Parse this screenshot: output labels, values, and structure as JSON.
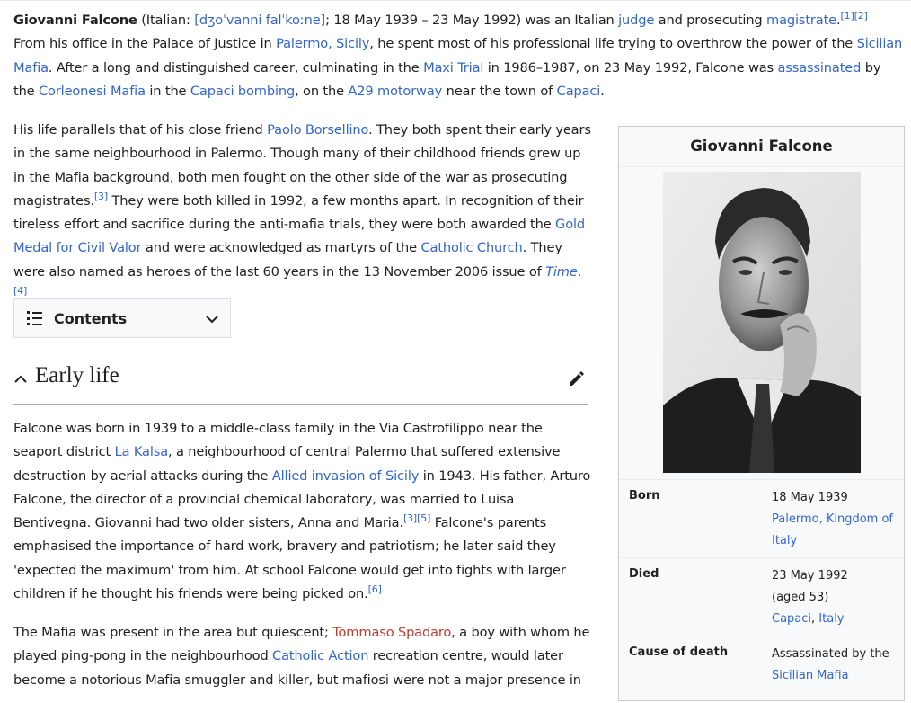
{
  "intro": {
    "name": "Giovanni Falcone",
    "t1": " (Italian: ",
    "ipa": "[dʒoˈvanni falˈkoːne]",
    "t2": "; 18 May 1939 – 23 May 1992) was an Italian ",
    "judge": "judge",
    "t3": " and prosecuting ",
    "magistrate": "magistrate",
    "ref1": "[1]",
    "ref2": "[2]",
    "t4": " From his office in the Palace of Justice in ",
    "palermo": "Palermo, Sicily",
    "t5": ", he spent most of his professional life trying to overthrow the power of the ",
    "sicilian_mafia": "Sicilian Mafia",
    "t6": ". After a long and distinguished career, culminating in the ",
    "maxi_trial": "Maxi Trial",
    "t7": " in 1986–1987, on 23 May 1992, Falcone was ",
    "assassinated": "assassinated",
    "t8": " by the ",
    "corleonesi": "Corleonesi Mafia",
    "t9": " in the ",
    "capaci_bombing": "Capaci bombing",
    "t10": ", on the ",
    "a29": "A29 motorway",
    "t11": " near the town of ",
    "capaci": "Capaci",
    "t12": "."
  },
  "para2": {
    "t1": "His life parallels that of his close friend ",
    "borsellino": "Paolo Borsellino",
    "t2": ". They both spent their early years in the same neighbourhood in Palermo. Though many of their childhood friends grew up in the Mafia background, both men fought on the other side of the war as prosecuting magistrates.",
    "ref3": "[3]",
    "t3": " They were both killed in 1992, a few months apart. In recognition of their tireless effort and sacrifice during the anti-mafia trials, they were both awarded the ",
    "gold_medal": "Gold Medal for Civil Valor",
    "t4": " and were acknowledged as martyrs of the ",
    "catholic_church": "Catholic Church",
    "t5": ". They were also named as heroes of the last 60 years in the 13 November 2006 issue of ",
    "time": "Time",
    "t6": ".",
    "ref4": "[4]"
  },
  "contents": {
    "label": "Contents"
  },
  "section": {
    "title": "Early life"
  },
  "para3": {
    "t1": "Falcone was born in 1939 to a middle-class family in the Via Castrofilippo near the seaport district ",
    "la_kalsa": "La Kalsa",
    "t2": ", a neighbourhood of central Palermo that suffered extensive destruction by aerial attacks during the ",
    "allied": "Allied invasion of Sicily",
    "t3": " in 1943. His father, Arturo Falcone, the director of a provincial chemical laboratory, was married to Luisa Bentivegna. Giovanni had two older sisters, Anna and Maria.",
    "ref3": "[3]",
    "ref5": "[5]",
    "t4": " Falcone's parents emphasised the importance of hard work, bravery and patriotism; he later said they 'expected the maximum' from him. At school Falcone would get into fights with larger children if he thought his friends were being picked on.",
    "ref6": "[6]"
  },
  "para4": {
    "t1": "The Mafia was present in the area but quiescent; ",
    "spadaro": "Tommaso Spadaro",
    "t2": ", a boy with whom he played ping-pong in the neighbourhood ",
    "catholic_action": "Catholic Action",
    "t3": " recreation centre, would later become a notorious Mafia smuggler and killer, but mafiosi were not a major presence in"
  },
  "infobox": {
    "title": "Giovanni Falcone",
    "born_label": "Born",
    "born_date": "18 May 1939",
    "born_place": "Palermo, Kingdom of Italy",
    "died_label": "Died",
    "died_date": "23 May 1992",
    "died_age": "(aged 53)",
    "died_place1": "Capaci",
    "died_sep": ", ",
    "died_place2": "Italy",
    "cause_label": "Cause of death",
    "cause_text": "Assassinated by the ",
    "cause_link": "Sicilian Mafia"
  }
}
